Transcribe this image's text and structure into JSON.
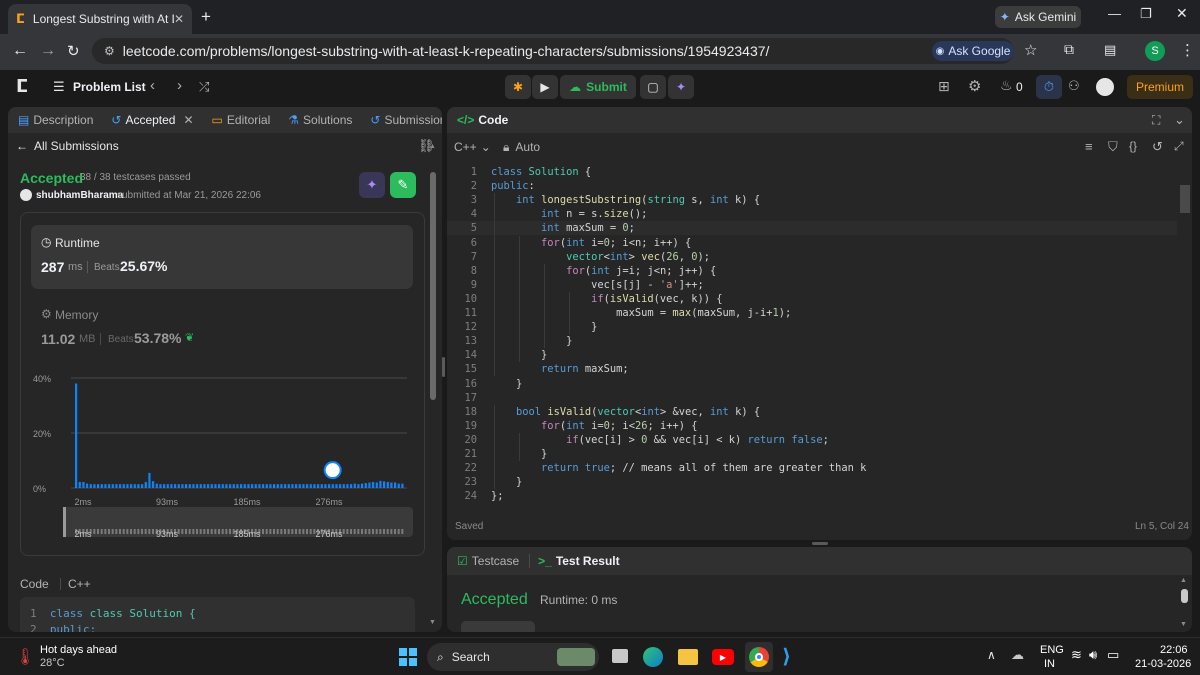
{
  "browser": {
    "tab_title": "Longest Substring with At Least",
    "url": "leetcode.com/problems/longest-substring-with-at-least-k-repeating-characters/submissions/1954923437/",
    "ask_gemini": "Ask Gemini",
    "ask_google": "Ask Google",
    "profile_initial": "S"
  },
  "nav": {
    "problem_list": "Problem List",
    "submit": "Submit",
    "streak": "0",
    "premium": "Premium"
  },
  "left_tabs": [
    {
      "label": "Description"
    },
    {
      "label": "Accepted"
    },
    {
      "label": "Editorial"
    },
    {
      "label": "Solutions"
    },
    {
      "label": "Submissions"
    }
  ],
  "submission": {
    "back_label": "All Submissions",
    "status": "Accepted",
    "testcases": "38 / 38 testcases passed",
    "user": "shubhamBharama",
    "submitted_at": "submitted at Mar 21, 2026 22:06",
    "runtime_label": "Runtime",
    "runtime_value": "287",
    "runtime_unit": "ms",
    "runtime_beats_label": "Beats",
    "runtime_beats": "25.67%",
    "memory_label": "Memory",
    "memory_value": "11.02",
    "memory_unit": "MB",
    "memory_beats_label": "Beats",
    "memory_beats": "53.78%",
    "code_label": "Code",
    "code_lang": "C++",
    "preview_lines": [
      "class Solution {",
      "public:"
    ]
  },
  "chart_data": {
    "type": "bar",
    "ytick_labels": [
      "40%",
      "20%",
      "0%"
    ],
    "ylim": [
      0,
      40
    ],
    "xtick_labels": [
      "2ms",
      "93ms",
      "185ms",
      "276ms"
    ],
    "values": [
      38,
      2.2,
      2.2,
      1.6,
      1.4,
      1.4,
      1.4,
      1.4,
      1.4,
      1.4,
      1.4,
      1.4,
      1.4,
      1.4,
      1.4,
      1.4,
      1.4,
      1.4,
      1.4,
      2.2,
      5.5,
      2.5,
      1.6,
      1.4,
      1.4,
      1.4,
      1.4,
      1.4,
      1.4,
      1.4,
      1.4,
      1.4,
      1.4,
      1.4,
      1.4,
      1.4,
      1.4,
      1.4,
      1.4,
      1.4,
      1.4,
      1.4,
      1.4,
      1.4,
      1.4,
      1.4,
      1.4,
      1.4,
      1.4,
      1.4,
      1.4,
      1.4,
      1.4,
      1.4,
      1.4,
      1.4,
      1.4,
      1.4,
      1.4,
      1.4,
      1.4,
      1.4,
      1.4,
      1.4,
      1.4,
      1.4,
      1.4,
      1.4,
      1.4,
      1.4,
      1.4,
      1.4,
      1.4,
      1.4,
      1.4,
      1.4,
      1.6,
      1.4,
      1.6,
      1.8,
      2.0,
      2.2,
      2.0,
      2.6,
      2.4,
      2.2,
      2.0,
      2.0,
      1.6,
      1.6
    ],
    "highlight_index": 70,
    "mini_labels": [
      "2ms",
      "93ms",
      "185ms",
      "276ms"
    ]
  },
  "editor": {
    "header": "Code",
    "lang": "C++",
    "mode": "Auto",
    "status_left": "Saved",
    "status_right": "Ln 5, Col 24",
    "lines": [
      "class Solution {",
      "public:",
      "    int longestSubstring(string s, int k) {",
      "        int n = s.size();",
      "        int maxSum = 0;",
      "        for(int i=0; i<n; i++) {",
      "            vector<int> vec(26, 0);",
      "            for(int j=i; j<n; j++) {",
      "                vec[s[j] - 'a']++;",
      "                if(isValid(vec, k)) {",
      "                    maxSum = max(maxSum, j-i+1);",
      "                }",
      "            }",
      "        }",
      "        return maxSum;",
      "    }",
      "",
      "    bool isValid(vector<int> &vec, int k) {",
      "        for(int i=0; i<26; i++) {",
      "            if(vec[i] > 0 && vec[i] < k) return false;",
      "        }",
      "        return true; // means all of them are greater than k",
      "    }",
      "};"
    ]
  },
  "test": {
    "tab_testcase": "Testcase",
    "tab_result": "Test Result",
    "status": "Accepted",
    "runtime": "Runtime: 0 ms"
  },
  "taskbar": {
    "weather_title": "Hot days ahead",
    "weather_temp": "28°C",
    "search": "Search",
    "lang1": "ENG",
    "lang2": "IN",
    "time": "22:06",
    "date": "21-03-2026"
  },
  "colors": {
    "accent_green": "#2cbb5d",
    "premium": "#ffa116",
    "bar": "#0a84ff"
  }
}
